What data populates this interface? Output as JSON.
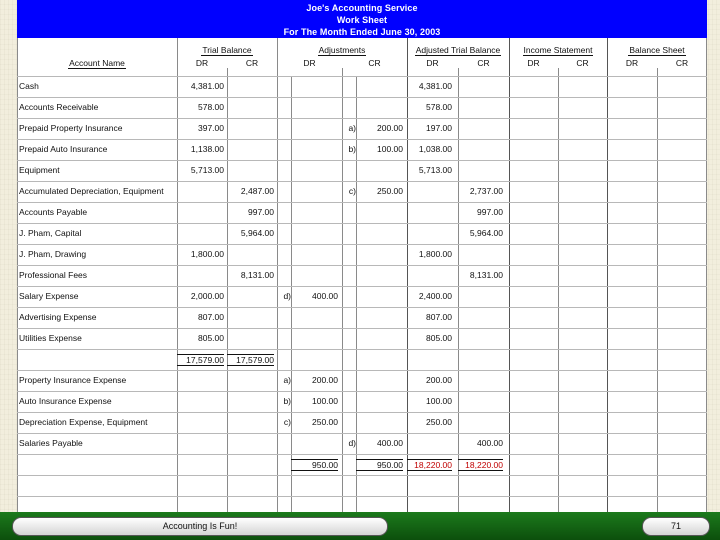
{
  "header": {
    "company": "Joe's Accounting Service",
    "title": "Work Sheet",
    "period": "For The Month Ended June 30, 2003"
  },
  "columns": {
    "account_name": "Account Name",
    "trial_balance": "Trial Balance",
    "adjustments": "Adjustments",
    "adjusted_trial_balance": "Adjusted Trial Balance",
    "income_statement": "Income Statement",
    "balance_sheet": "Balance Sheet",
    "dr": "DR",
    "cr": "CR"
  },
  "rows": [
    {
      "account": "Cash",
      "tb_dr": "4,381.00",
      "tb_cr": "",
      "adj_dr_ref": "",
      "adj_dr": "",
      "adj_cr_ref": "",
      "adj_cr": "",
      "atb_dr": "4,381.00",
      "atb_cr": ""
    },
    {
      "account": "Accounts Receivable",
      "tb_dr": "578.00",
      "tb_cr": "",
      "adj_dr_ref": "",
      "adj_dr": "",
      "adj_cr_ref": "",
      "adj_cr": "",
      "atb_dr": "578.00",
      "atb_cr": ""
    },
    {
      "account": "Prepaid Property Insurance",
      "tb_dr": "397.00",
      "tb_cr": "",
      "adj_dr_ref": "",
      "adj_dr": "",
      "adj_cr_ref": "a)",
      "adj_cr": "200.00",
      "atb_dr": "197.00",
      "atb_cr": ""
    },
    {
      "account": "Prepaid Auto Insurance",
      "tb_dr": "1,138.00",
      "tb_cr": "",
      "adj_dr_ref": "",
      "adj_dr": "",
      "adj_cr_ref": "b)",
      "adj_cr": "100.00",
      "atb_dr": "1,038.00",
      "atb_cr": ""
    },
    {
      "account": "Equipment",
      "tb_dr": "5,713.00",
      "tb_cr": "",
      "adj_dr_ref": "",
      "adj_dr": "",
      "adj_cr_ref": "",
      "adj_cr": "",
      "atb_dr": "5,713.00",
      "atb_cr": ""
    },
    {
      "account": "Accumulated Depreciation, Equipment",
      "tb_dr": "",
      "tb_cr": "2,487.00",
      "adj_dr_ref": "",
      "adj_dr": "",
      "adj_cr_ref": "c)",
      "adj_cr": "250.00",
      "atb_dr": "",
      "atb_cr": "2,737.00"
    },
    {
      "account": "Accounts Payable",
      "tb_dr": "",
      "tb_cr": "997.00",
      "adj_dr_ref": "",
      "adj_dr": "",
      "adj_cr_ref": "",
      "adj_cr": "",
      "atb_dr": "",
      "atb_cr": "997.00"
    },
    {
      "account": "J. Pham, Capital",
      "tb_dr": "",
      "tb_cr": "5,964.00",
      "adj_dr_ref": "",
      "adj_dr": "",
      "adj_cr_ref": "",
      "adj_cr": "",
      "atb_dr": "",
      "atb_cr": "5,964.00"
    },
    {
      "account": "J. Pham, Drawing",
      "tb_dr": "1,800.00",
      "tb_cr": "",
      "adj_dr_ref": "",
      "adj_dr": "",
      "adj_cr_ref": "",
      "adj_cr": "",
      "atb_dr": "1,800.00",
      "atb_cr": ""
    },
    {
      "account": "Professional Fees",
      "tb_dr": "",
      "tb_cr": "8,131.00",
      "adj_dr_ref": "",
      "adj_dr": "",
      "adj_cr_ref": "",
      "adj_cr": "",
      "atb_dr": "",
      "atb_cr": "8,131.00"
    },
    {
      "account": "Salary Expense",
      "tb_dr": "2,000.00",
      "tb_cr": "",
      "adj_dr_ref": "d)",
      "adj_dr": "400.00",
      "adj_cr_ref": "",
      "adj_cr": "",
      "atb_dr": "2,400.00",
      "atb_cr": ""
    },
    {
      "account": "Advertising Expense",
      "tb_dr": "807.00",
      "tb_cr": "",
      "adj_dr_ref": "",
      "adj_dr": "",
      "adj_cr_ref": "",
      "adj_cr": "",
      "atb_dr": "807.00",
      "atb_cr": ""
    },
    {
      "account": "Utilities Expense",
      "tb_dr": "805.00",
      "tb_cr": "",
      "adj_dr_ref": "",
      "adj_dr": "",
      "adj_cr_ref": "",
      "adj_cr": "",
      "atb_dr": "805.00",
      "atb_cr": ""
    },
    {
      "account": "",
      "tb_dr": "17,579.00",
      "tb_cr": "17,579.00",
      "adj_dr_ref": "",
      "adj_dr": "",
      "adj_cr_ref": "",
      "adj_cr": "",
      "atb_dr": "",
      "atb_cr": "",
      "is_total": true
    },
    {
      "account": "Property Insurance Expense",
      "tb_dr": "",
      "tb_cr": "",
      "adj_dr_ref": "a)",
      "adj_dr": "200.00",
      "adj_cr_ref": "",
      "adj_cr": "",
      "atb_dr": "200.00",
      "atb_cr": ""
    },
    {
      "account": "Auto Insurance Expense",
      "tb_dr": "",
      "tb_cr": "",
      "adj_dr_ref": "b)",
      "adj_dr": "100.00",
      "adj_cr_ref": "",
      "adj_cr": "",
      "atb_dr": "100.00",
      "atb_cr": ""
    },
    {
      "account": "Depreciation Expense, Equipment",
      "tb_dr": "",
      "tb_cr": "",
      "adj_dr_ref": "c)",
      "adj_dr": "250.00",
      "adj_cr_ref": "",
      "adj_cr": "",
      "atb_dr": "250.00",
      "atb_cr": ""
    },
    {
      "account": "Salaries Payable",
      "tb_dr": "",
      "tb_cr": "",
      "adj_dr_ref": "",
      "adj_dr": "",
      "adj_cr_ref": "d)",
      "adj_cr": "400.00",
      "atb_dr": "",
      "atb_cr": "400.00"
    },
    {
      "account": "",
      "tb_dr": "",
      "tb_cr": "",
      "adj_dr_ref": "",
      "adj_dr": "950.00",
      "adj_cr_ref": "",
      "adj_cr": "950.00",
      "atb_dr": "18,220.00",
      "atb_cr": "18,220.00",
      "is_total": true,
      "atb_red": true
    }
  ],
  "footer": {
    "caption": "Accounting Is Fun!",
    "page_number": "71"
  },
  "colors": {
    "header_bg": "#0000ff",
    "footer_bg": "#1a6b1a",
    "total_red": "#c00000"
  }
}
